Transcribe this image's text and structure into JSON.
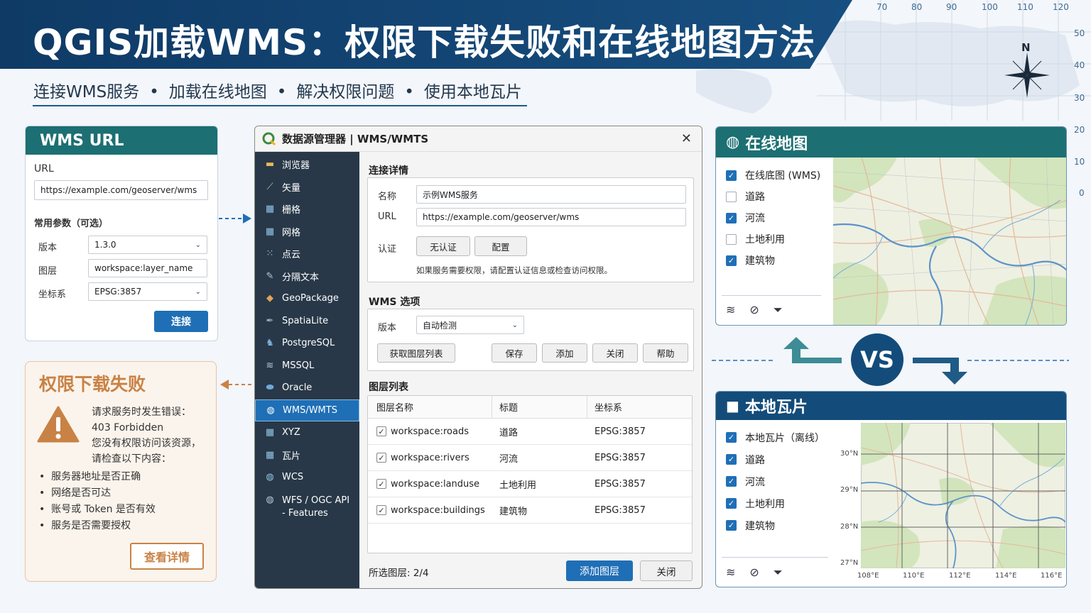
{
  "header": {
    "title": "QGIS加载WMS：权限下载失败和在线地图方法",
    "subtitle_items": [
      "连接WMS服务",
      "加载在线地图",
      "解决权限问题",
      "使用本地瓦片"
    ],
    "subtitle_sep": "•",
    "grid_top": [
      "70",
      "80",
      "90",
      "100",
      "110",
      "120"
    ],
    "grid_right": [
      "50",
      "40",
      "30",
      "20",
      "10",
      "0"
    ],
    "compass_label": "N"
  },
  "wms_card": {
    "title": "WMS URL",
    "url_label": "URL",
    "url_value": "https://example.com/geoserver/wms",
    "params_label": "常用参数（可选）",
    "version_label": "版本",
    "version_value": "1.3.0",
    "layer_label": "图层",
    "layer_value": "workspace:layer_name",
    "crs_label": "坐标系",
    "crs_value": "EPSG:3857",
    "connect_label": "连接"
  },
  "error_card": {
    "title": "权限下载失败",
    "lines": [
      "请求服务时发生错误：",
      "403 Forbidden",
      "您没有权限访问该资源，",
      "请检查以下内容："
    ],
    "bullets": [
      "服务器地址是否正确",
      "网络是否可达",
      "账号或 Token 是否有效",
      "服务是否需要授权"
    ],
    "bullet_mark": "•",
    "details_label": "查看详情"
  },
  "dialog": {
    "title": "数据源管理器 | WMS/WMTS",
    "sidebar": [
      {
        "label": "浏览器",
        "icon": "folder-icon"
      },
      {
        "label": "矢量",
        "icon": "vector-icon"
      },
      {
        "label": "栅格",
        "icon": "raster-icon"
      },
      {
        "label": "网格",
        "icon": "mesh-icon"
      },
      {
        "label": "点云",
        "icon": "point-cloud-icon"
      },
      {
        "label": "分隔文本",
        "icon": "delimited-text-icon"
      },
      {
        "label": "GeoPackage",
        "icon": "geopackage-icon"
      },
      {
        "label": "SpatiaLite",
        "icon": "spatialite-icon"
      },
      {
        "label": "PostgreSQL",
        "icon": "postgresql-icon"
      },
      {
        "label": "MSSQL",
        "icon": "mssql-icon"
      },
      {
        "label": "Oracle",
        "icon": "oracle-icon"
      },
      {
        "label": "WMS/WMTS",
        "icon": "globe-icon"
      },
      {
        "label": "XYZ",
        "icon": "xyz-icon"
      },
      {
        "label": "瓦片",
        "icon": "tile-icon"
      },
      {
        "label": "WCS",
        "icon": "wcs-icon"
      },
      {
        "label": "WFS / OGC API - Features",
        "icon": "wfs-icon"
      }
    ],
    "connection": {
      "section_title": "连接详情",
      "name_label": "名称",
      "name_value": "示例WMS服务",
      "url_label": "URL",
      "url_value": "https://example.com/geoserver/wms",
      "auth_label": "认证",
      "no_auth_label": "无认证",
      "config_label": "配置",
      "hint": "如果服务需要权限，请配置认证信息或检查访问权限。"
    },
    "options": {
      "section_title": "WMS 选项",
      "version_label": "版本",
      "version_value": "自动检测",
      "buttons": [
        "获取图层列表",
        "保存",
        "添加",
        "关闭",
        "帮助"
      ]
    },
    "layers": {
      "section_title": "图层列表",
      "columns": [
        "图层名称",
        "标题",
        "坐标系"
      ],
      "rows": [
        {
          "name": "workspace:roads",
          "title": "道路",
          "crs": "EPSG:3857"
        },
        {
          "name": "workspace:rivers",
          "title": "河流",
          "crs": "EPSG:3857"
        },
        {
          "name": "workspace:landuse",
          "title": "土地利用",
          "crs": "EPSG:3857"
        },
        {
          "name": "workspace:buildings",
          "title": "建筑物",
          "crs": "EPSG:3857"
        }
      ],
      "check_mark": "✓"
    },
    "footer": {
      "selected": "所选图层: 2/4",
      "add_layer": "添加图层",
      "close": "关闭"
    }
  },
  "online_panel": {
    "title": "在线地图",
    "items": [
      {
        "label": "在线底图 (WMS)",
        "checked": true
      },
      {
        "label": "道路",
        "checked": false
      },
      {
        "label": "河流",
        "checked": true
      },
      {
        "label": "土地利用",
        "checked": false
      },
      {
        "label": "建筑物",
        "checked": true
      }
    ]
  },
  "vs_label": "VS",
  "local_panel": {
    "title": "本地瓦片",
    "items": [
      {
        "label": "本地瓦片（离线）",
        "checked": true
      },
      {
        "label": "道路",
        "checked": true
      },
      {
        "label": "河流",
        "checked": true
      },
      {
        "label": "土地利用",
        "checked": true
      },
      {
        "label": "建筑物",
        "checked": true
      }
    ],
    "lat_ticks": [
      "30°N",
      "29°N",
      "28°N",
      "27°N"
    ],
    "lon_ticks": [
      "108°E",
      "110°E",
      "112°E",
      "114°E",
      "116°E"
    ]
  },
  "colors": {
    "navy": "#134c7a",
    "teal": "#1c6f72",
    "blue_button": "#1f6fb6",
    "error_accent": "#c98245"
  }
}
